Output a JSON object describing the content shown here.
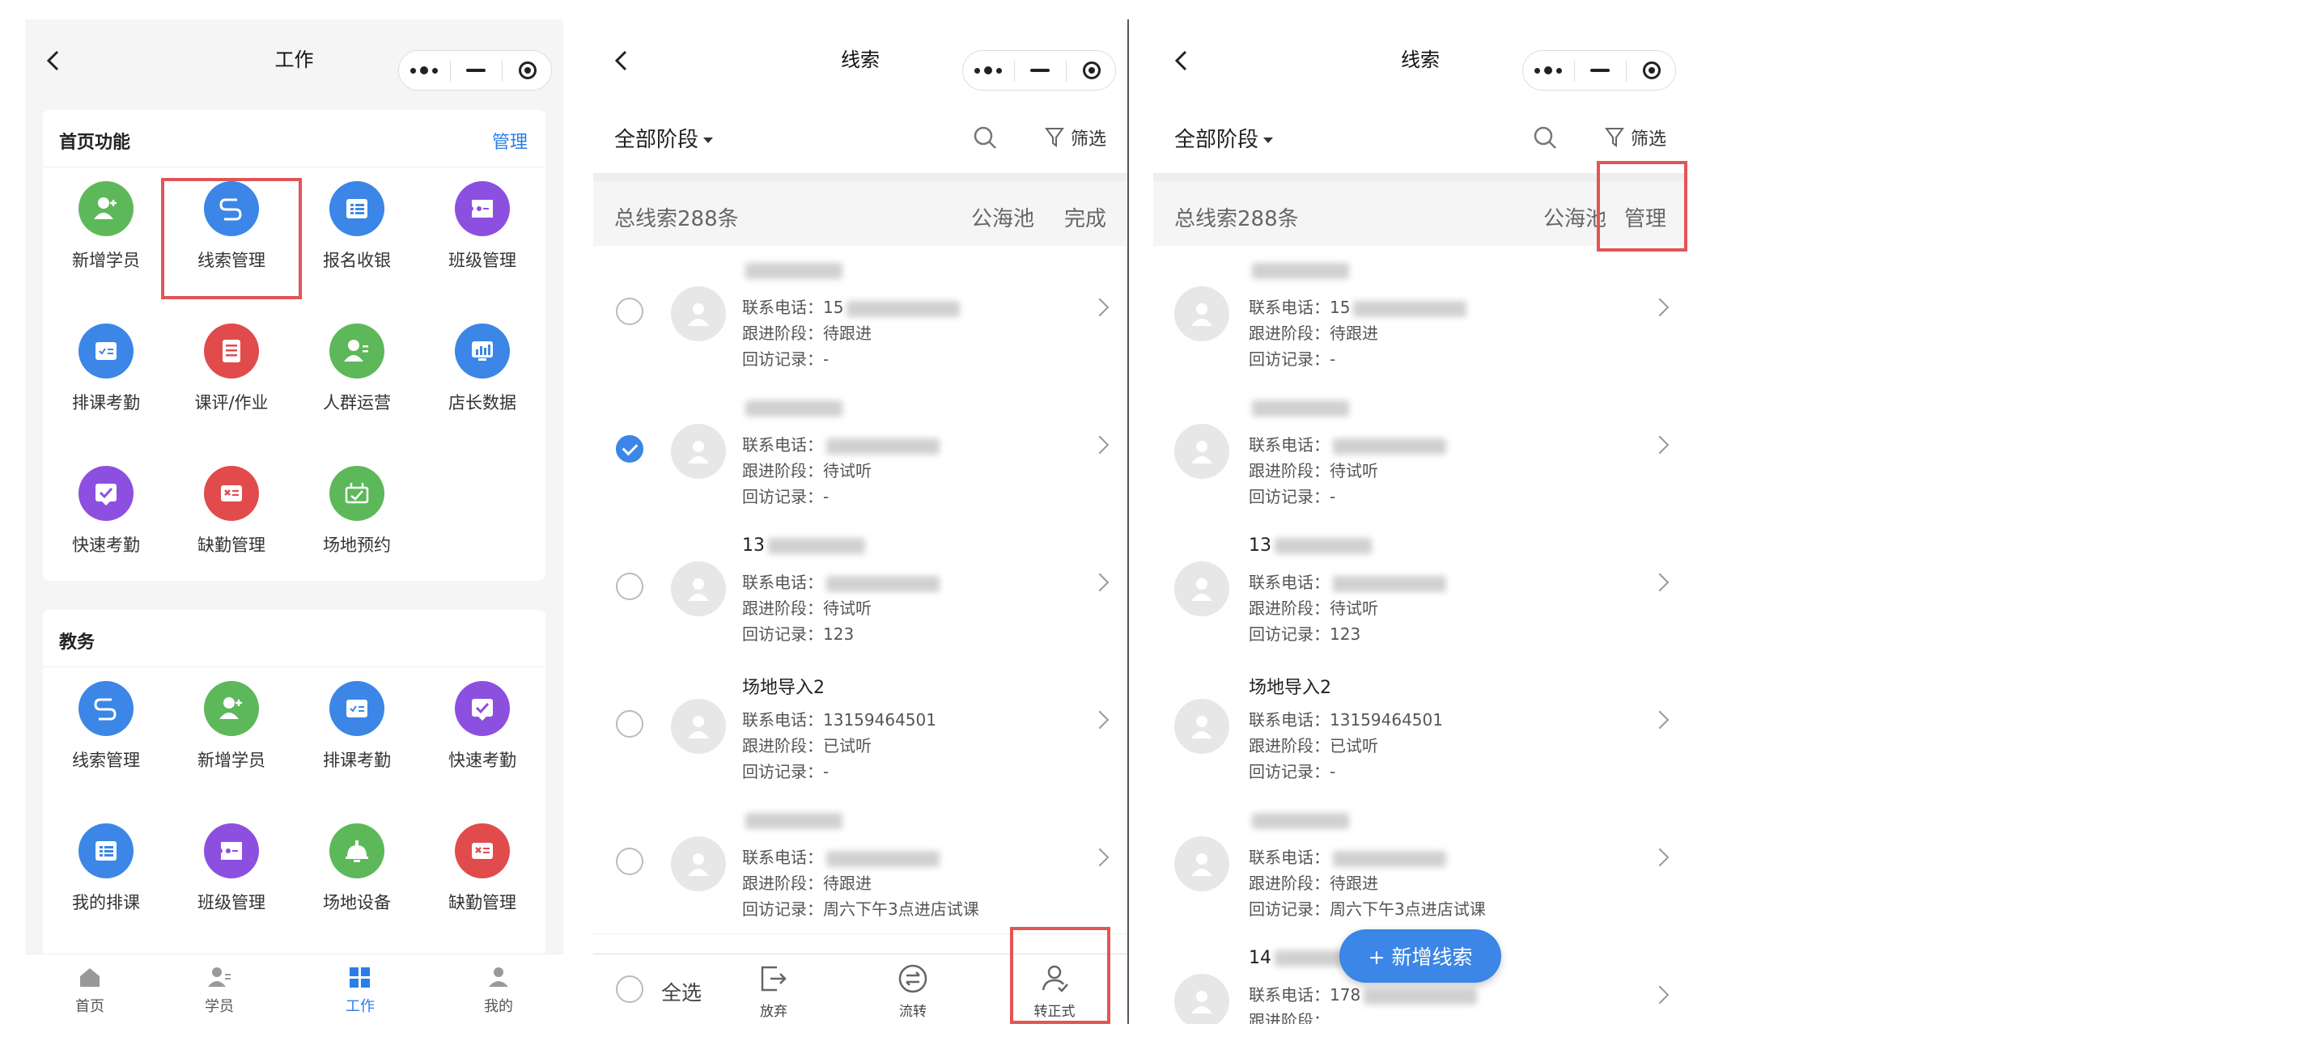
{
  "phone1": {
    "title": "工作",
    "section1": {
      "title": "首页功能",
      "manage": "管理",
      "items": [
        {
          "label": "新增学员",
          "icon": "add-user-icon",
          "color": "#5db85a"
        },
        {
          "label": "线索管理",
          "icon": "route-icon",
          "color": "#3b86e6"
        },
        {
          "label": "报名收银",
          "icon": "list-icon",
          "color": "#3b86e6"
        },
        {
          "label": "班级管理",
          "icon": "ticket-icon",
          "color": "#8d4fe0"
        },
        {
          "label": "排课考勤",
          "icon": "schedule-icon",
          "color": "#3b86e6"
        },
        {
          "label": "课评/作业",
          "icon": "document-icon",
          "color": "#e14b4b"
        },
        {
          "label": "人群运营",
          "icon": "group-icon",
          "color": "#5db85a"
        },
        {
          "label": "店长数据",
          "icon": "chart-icon",
          "color": "#3b86e6"
        },
        {
          "label": "快速考勤",
          "icon": "check-icon",
          "color": "#8d4fe0"
        },
        {
          "label": "缺勤管理",
          "icon": "absence-icon",
          "color": "#e14b4b"
        },
        {
          "label": "场地预约",
          "icon": "venue-icon",
          "color": "#5db85a"
        }
      ]
    },
    "section2": {
      "title": "教务",
      "items": [
        {
          "label": "线索管理",
          "icon": "route-icon",
          "color": "#3b86e6"
        },
        {
          "label": "新增学员",
          "icon": "add-user-icon",
          "color": "#5db85a"
        },
        {
          "label": "排课考勤",
          "icon": "schedule-icon",
          "color": "#3b86e6"
        },
        {
          "label": "快速考勤",
          "icon": "check-icon",
          "color": "#8d4fe0"
        },
        {
          "label": "我的排课",
          "icon": "list-icon",
          "color": "#3b86e6"
        },
        {
          "label": "班级管理",
          "icon": "ticket-icon",
          "color": "#8d4fe0"
        },
        {
          "label": "场地设备",
          "icon": "bell-icon",
          "color": "#5db85a"
        },
        {
          "label": "缺勤管理",
          "icon": "absence-icon",
          "color": "#e14b4b"
        }
      ]
    },
    "tabs": [
      {
        "label": "首页",
        "icon": "home-icon"
      },
      {
        "label": "学员",
        "icon": "student-icon"
      },
      {
        "label": "工作",
        "icon": "grid-icon",
        "active": true
      },
      {
        "label": "我的",
        "icon": "profile-icon"
      }
    ]
  },
  "list": {
    "title": "线索",
    "stage": "全部阶段",
    "filter": "筛选",
    "summary": "总线索288条",
    "pool": "公海池",
    "done": "完成",
    "manage": "管理",
    "phone_label": "联系电话：",
    "stage_label": "跟进阶段：",
    "record_label": "回访记录：",
    "rows": [
      {
        "name": "",
        "phone": "15",
        "stage": "待跟进",
        "record": "-",
        "checked": false
      },
      {
        "name": "",
        "phone": "",
        "stage": "待试听",
        "record": "-",
        "checked": true
      },
      {
        "name": "13",
        "phone": "",
        "stage": "待试听",
        "record": "123",
        "checked": false
      },
      {
        "name": "场地导入2",
        "phone": "13159464501",
        "stage": "已试听",
        "record": "-",
        "checked": false
      },
      {
        "name": "",
        "phone": "",
        "stage": "待跟进",
        "record": "周六下午3点进店试课",
        "checked": false
      },
      {
        "name": "14",
        "phone": "178",
        "stage": "",
        "record": "",
        "checked": false
      }
    ],
    "bottom": {
      "select_all": "全选",
      "abandon": "放弃",
      "transfer": "流转",
      "convert": "转正式"
    },
    "fab": "+ 新增线索"
  },
  "colors": {
    "accent": "#2b7de9",
    "highlight": "#e25555"
  }
}
